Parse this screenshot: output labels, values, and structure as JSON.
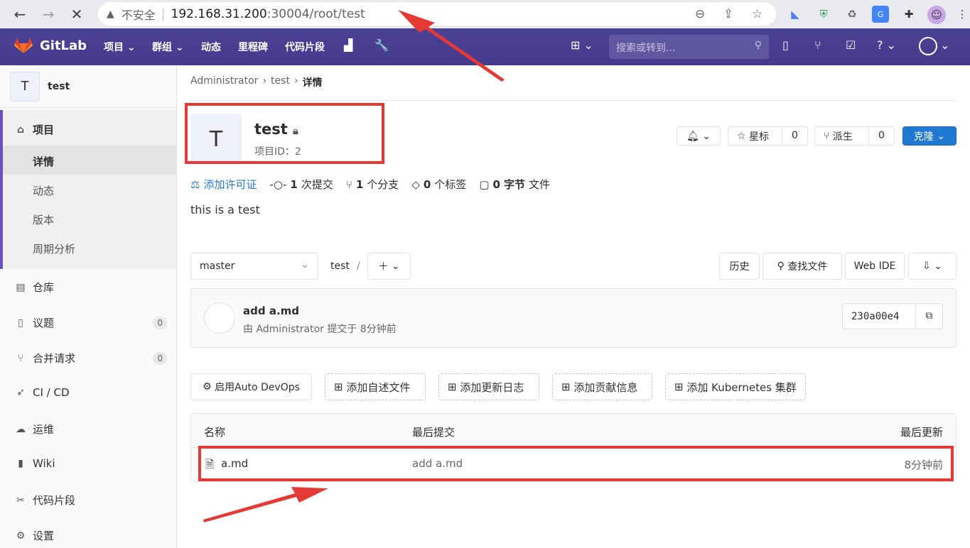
{
  "browser": {
    "insecure_label": "不安全",
    "url_host": "192.168.31.200",
    "url_path": ":30004/root/test"
  },
  "navbar": {
    "brand": "GitLab",
    "menu": [
      "项目",
      "群组",
      "动态",
      "里程碑",
      "代码片段"
    ],
    "search_placeholder": "搜索或转到..."
  },
  "sidebar": {
    "project_initial": "T",
    "project_name": "test",
    "section": "项目",
    "sub_items": [
      "详情",
      "动态",
      "版本",
      "周期分析"
    ],
    "items": [
      {
        "label": "仓库",
        "badge": ""
      },
      {
        "label": "议题",
        "badge": "0"
      },
      {
        "label": "合并请求",
        "badge": "0"
      },
      {
        "label": "CI / CD",
        "badge": ""
      },
      {
        "label": "运维",
        "badge": ""
      },
      {
        "label": "Wiki",
        "badge": ""
      },
      {
        "label": "代码片段",
        "badge": ""
      },
      {
        "label": "设置",
        "badge": ""
      }
    ]
  },
  "breadcrumb": [
    "Administrator",
    "test",
    "详情"
  ],
  "project": {
    "initial": "T",
    "title": "test",
    "id_label": "项目ID：2",
    "star_label": "星标",
    "star_count": "0",
    "fork_label": "派生",
    "fork_count": "0",
    "clone_label": "克隆",
    "description": "this is a test"
  },
  "stats": {
    "license": "添加许可证",
    "commits_num": "1",
    "commits_label": "次提交",
    "branches_num": "1",
    "branches_label": "个分支",
    "tags_num": "0",
    "tags_label": "个标签",
    "size_num": "0",
    "size_label": "字节",
    "files_label": "文件"
  },
  "repo": {
    "branch": "master",
    "path": "test",
    "path_sep": "/",
    "history": "历史",
    "find_file": "查找文件",
    "web_ide": "Web IDE"
  },
  "commit": {
    "title": "add a.md",
    "meta": "由 Administrator 提交于 8分钟前",
    "sha": "230a00e4"
  },
  "actions": {
    "auto_devops": "启用Auto DevOps",
    "readme": "添加自述文件",
    "changelog": "添加更新日志",
    "contributing": "添加贡献信息",
    "k8s": "添加 Kubernetes 集群"
  },
  "table": {
    "headers": [
      "名称",
      "最后提交",
      "最后更新"
    ],
    "rows": [
      {
        "name": "a.md",
        "last_commit": "add a.md",
        "updated": "8分钟前"
      }
    ]
  },
  "colors": {
    "navbar": "#453a8e",
    "accent": "#1f78d1",
    "annotation": "#e53935"
  }
}
